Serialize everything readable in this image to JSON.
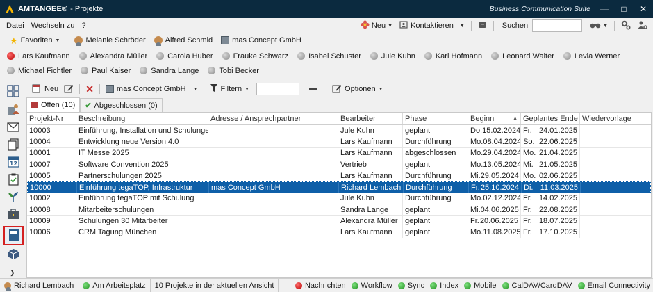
{
  "window": {
    "app_name": "AMTANGEE®",
    "title": "- Projekte",
    "suite": "Business Communication Suite"
  },
  "menu": {
    "items": [
      "Datei",
      "Wechseln zu",
      "?"
    ],
    "new_label": "Neu",
    "contacts_label": "Kontaktieren",
    "search_label": "Suchen",
    "search_value": ""
  },
  "favorites": {
    "label": "Favoriten",
    "items": [
      {
        "label": "Melanie Schröder",
        "icon": "person-icon"
      },
      {
        "label": "Alfred Schmid",
        "icon": "person-icon"
      },
      {
        "label": "mas Concept GmbH",
        "icon": "building-icon"
      }
    ]
  },
  "users": [
    {
      "name": "Lars Kaufmann",
      "status": "red"
    },
    {
      "name": "Alexandra Müller",
      "status": "gray"
    },
    {
      "name": "Carola Huber",
      "status": "gray"
    },
    {
      "name": "Frauke Schwarz",
      "status": "gray"
    },
    {
      "name": "Isabel Schuster",
      "status": "gray"
    },
    {
      "name": "Jule Kuhn",
      "status": "gray"
    },
    {
      "name": "Karl Hofmann",
      "status": "gray"
    },
    {
      "name": "Leonard Walter",
      "status": "gray"
    },
    {
      "name": "Levia Werner",
      "status": "gray"
    },
    {
      "name": "Michael Fichtler",
      "status": "gray"
    },
    {
      "name": "Paul Kaiser",
      "status": "gray"
    },
    {
      "name": "Sandra Lange",
      "status": "gray"
    },
    {
      "name": "Tobi Becker",
      "status": "gray"
    }
  ],
  "toolbar": {
    "new_label": "Neu",
    "company_label": "mas Concept GmbH",
    "filter_label": "Filtern",
    "filter_value": "",
    "options_label": "Optionen"
  },
  "tabs": {
    "open": "Offen (10)",
    "closed": "Abgeschlossen (0)"
  },
  "table": {
    "headers": [
      "Projekt-Nr",
      "Beschreibung",
      "Adresse / Ansprechpartner",
      "Bearbeiter",
      "Phase",
      "Beginn",
      "Geplantes Ende",
      "Wiedervorlage"
    ],
    "rows": [
      {
        "nr": "10003",
        "desc": "Einführung, Installation und Schulungen",
        "addr": "",
        "editor": "Jule Kuhn",
        "phase": "geplant",
        "start_day": "Do.",
        "start": "15.02.2024",
        "end_day": "Fr.",
        "end": "24.01.2025",
        "follow": ""
      },
      {
        "nr": "10004",
        "desc": "Entwicklung neue Version 4.0",
        "addr": "",
        "editor": "Lars Kaufmann",
        "phase": "Durchführung",
        "start_day": "Mo.",
        "start": "08.04.2024",
        "end_day": "So.",
        "end": "22.06.2025",
        "follow": ""
      },
      {
        "nr": "10001",
        "desc": "IT Messe 2025",
        "addr": "",
        "editor": "Lars Kaufmann",
        "phase": "abgeschlossen",
        "start_day": "Mo.",
        "start": "29.04.2024",
        "end_day": "Mo.",
        "end": "21.04.2025",
        "follow": ""
      },
      {
        "nr": "10007",
        "desc": "Software Convention 2025",
        "addr": "",
        "editor": "Vertrieb",
        "phase": "geplant",
        "start_day": "Mo.",
        "start": "13.05.2024",
        "end_day": "Mi.",
        "end": "21.05.2025",
        "follow": ""
      },
      {
        "nr": "10005",
        "desc": "Partnerschulungen 2025",
        "addr": "",
        "editor": "Lars Kaufmann",
        "phase": "Durchführung",
        "start_day": "Mi.",
        "start": "29.05.2024",
        "end_day": "Mo.",
        "end": "02.06.2025",
        "follow": ""
      },
      {
        "nr": "10000",
        "desc": "Einführung tegaTOP, Infrastruktur",
        "addr": "mas Concept GmbH",
        "editor": "Richard Lembach",
        "phase": "Durchführung",
        "start_day": "Fr.",
        "start": "25.10.2024",
        "end_day": "Di.",
        "end": "11.03.2025",
        "follow": "",
        "selected": true
      },
      {
        "nr": "10002",
        "desc": "Einführung tegaTOP mit Schulung",
        "addr": "",
        "editor": "Jule Kuhn",
        "phase": "Durchführung",
        "start_day": "Mo.",
        "start": "02.12.2024",
        "end_day": "Fr.",
        "end": "14.02.2025",
        "follow": ""
      },
      {
        "nr": "10008",
        "desc": "Mitarbeiterschulungen",
        "addr": "",
        "editor": "Sandra Lange",
        "phase": "geplant",
        "start_day": "Mi.",
        "start": "04.06.2025",
        "end_day": "Fr.",
        "end": "22.08.2025",
        "follow": ""
      },
      {
        "nr": "10009",
        "desc": "Schulungen 30 Mitarbeiter",
        "addr": "",
        "editor": "Alexandra Müller",
        "phase": "geplant",
        "start_day": "Fr.",
        "start": "20.06.2025",
        "end_day": "Fr.",
        "end": "18.07.2025",
        "follow": ""
      },
      {
        "nr": "10006",
        "desc": "CRM Tagung München",
        "addr": "",
        "editor": "Lars Kaufmann",
        "phase": "geplant",
        "start_day": "Mo.",
        "start": "11.08.2025",
        "end_day": "Fr.",
        "end": "17.10.2025",
        "follow": ""
      }
    ]
  },
  "status": {
    "user": "Richard Lembach",
    "presence": "Am Arbeitsplatz",
    "count_text": "10 Projekte in der aktuellen Ansicht",
    "services": [
      {
        "label": "Nachrichten",
        "status": "red"
      },
      {
        "label": "Workflow",
        "status": "green"
      },
      {
        "label": "Sync",
        "status": "green"
      },
      {
        "label": "Index",
        "status": "green"
      },
      {
        "label": "Mobile",
        "status": "green"
      },
      {
        "label": "CalDAV/CardDAV",
        "status": "green"
      },
      {
        "label": "Email Connectivity",
        "status": "green"
      }
    ]
  }
}
